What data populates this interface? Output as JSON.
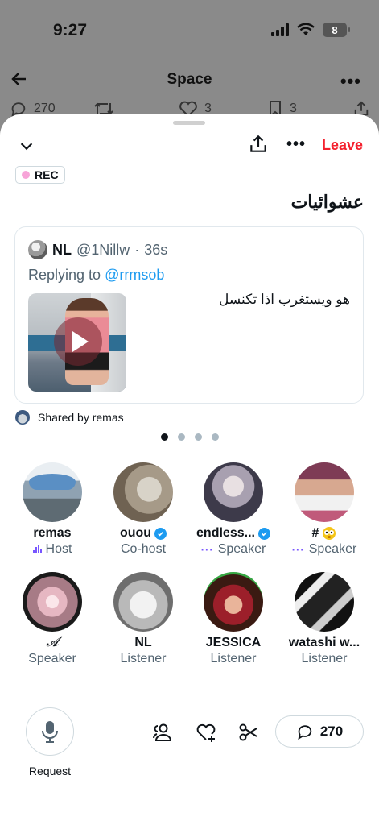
{
  "status_bar": {
    "time": "9:27",
    "battery": "8"
  },
  "background": {
    "title": "Space",
    "replies": "270",
    "likes": "3",
    "bookmarks": "3"
  },
  "sheet": {
    "leave_label": "Leave",
    "rec_label": "REC",
    "space_title": "عشوائيات",
    "pinned_post": {
      "name": "NL",
      "handle": "@1Nillw",
      "separator": "·",
      "time": "36s",
      "replying_prefix": "Replying to",
      "replying_to": "@rrmsob",
      "text": "هو ويستغرب اذا تكنسل"
    },
    "shared_by": "Shared by remas",
    "participants": [
      {
        "name": "remas",
        "role": "Host",
        "verified": false
      },
      {
        "name": "ouou",
        "role": "Co-host",
        "verified": true
      },
      {
        "name": "endless...",
        "role": "Speaker",
        "verified": true
      },
      {
        "name": "#",
        "role": "Speaker",
        "verified": false
      },
      {
        "name": "𝓐",
        "role": "Speaker",
        "verified": false
      },
      {
        "name": "NL",
        "role": "Listener",
        "verified": false
      },
      {
        "name": "JESSICA",
        "role": "Listener",
        "verified": false
      },
      {
        "name": "watashi w...",
        "role": "Listener",
        "verified": false
      }
    ],
    "request_label": "Request",
    "comment_count": "270"
  },
  "colors": {
    "leave": "#f4212e",
    "link": "#1d9bf0",
    "role_accent": "#7856ff",
    "rec_dot": "#f7a4d8"
  }
}
